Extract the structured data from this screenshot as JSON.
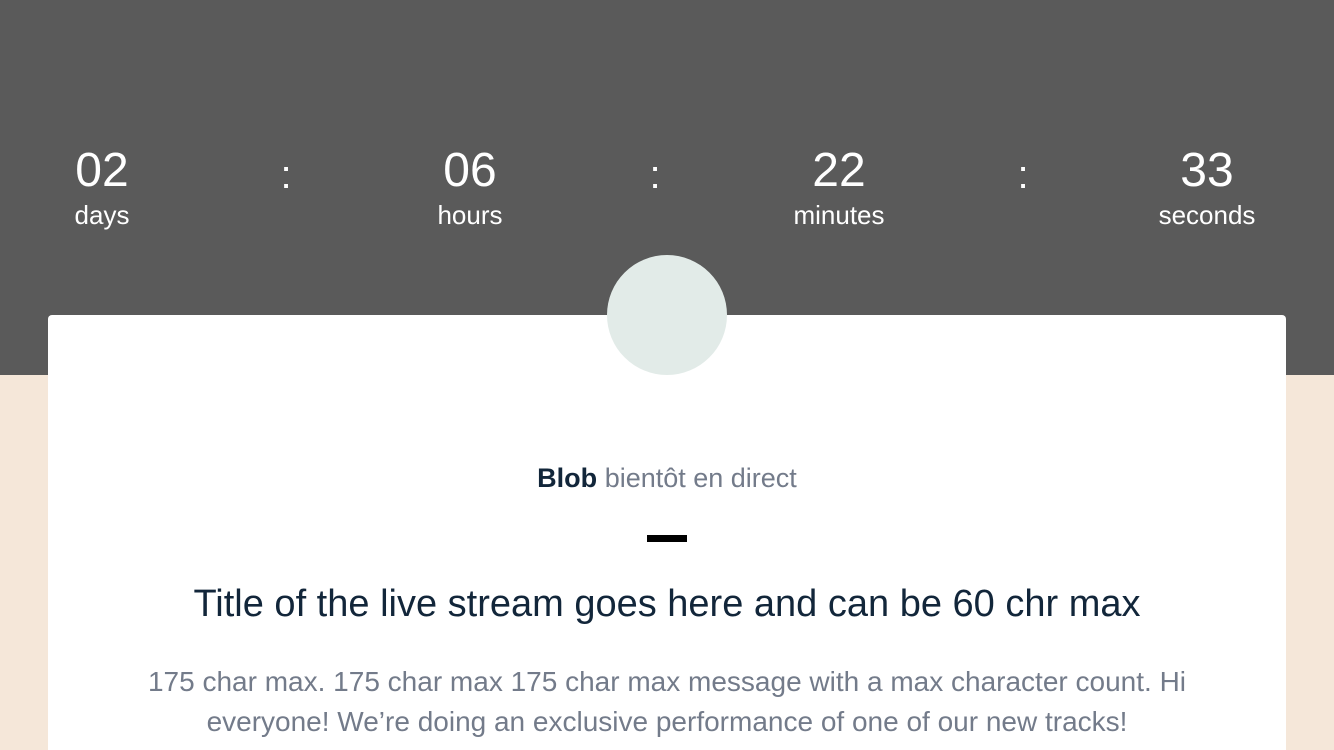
{
  "countdown": {
    "days": {
      "value": "02",
      "label": "days"
    },
    "hours": {
      "value": "06",
      "label": "hours"
    },
    "minutes": {
      "value": "22",
      "label": "minutes"
    },
    "seconds": {
      "value": "33",
      "label": "seconds"
    },
    "separator": ":"
  },
  "stream": {
    "artist_name": "Blob",
    "status_text": "bientôt en direct",
    "title": "Title of the live stream goes here and can be 60 chr max",
    "message": "175 char max. 175 char max 175 char max message with a max character count. Hi everyone! We’re doing an exclusive performance of one of our new tracks!"
  },
  "colors": {
    "header_background": "#5a5a5a",
    "page_background": "#f5e7d9",
    "card_background": "#ffffff",
    "avatar_placeholder": "#e2ebe8",
    "primary_text": "#12263a",
    "secondary_text": "#737b8a"
  }
}
